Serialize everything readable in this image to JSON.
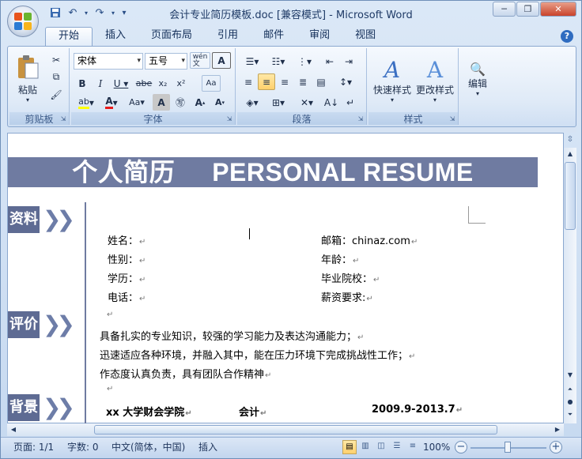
{
  "window": {
    "title": "会计专业简历模板.doc [兼容模式] - Microsoft Word"
  },
  "qat": {
    "save": "save-icon",
    "undo": "undo-icon",
    "redo": "redo-icon",
    "customize": "▾"
  },
  "tabs": [
    "开始",
    "插入",
    "页面布局",
    "引用",
    "邮件",
    "审阅",
    "视图"
  ],
  "ribbon": {
    "clipboard": {
      "paste": "粘贴",
      "label": "剪贴板"
    },
    "font": {
      "name": "宋体",
      "size": "五号",
      "label": "字体",
      "wen": "wén\n文"
    },
    "paragraph": {
      "label": "段落"
    },
    "styles": {
      "quick": "快速样式",
      "change": "更改样式",
      "label": "样式"
    },
    "editing": {
      "label": "编辑"
    }
  },
  "document": {
    "banner": "个人简历     PERSONAL RESUME",
    "sections": [
      "资料",
      "评价",
      "背景"
    ],
    "fields_left": [
      "姓名：",
      "性别：",
      "学历：",
      "电话："
    ],
    "fields_right": [
      "邮箱：chinaz.com",
      "年龄：",
      "毕业院校：",
      "薪资要求:"
    ],
    "evaluation": [
      "具备扎实的专业知识，较强的学习能力及表达沟通能力；",
      "迅速适应各种环境，并融入其中，能在压力环境下完成挑战性工作；",
      "作态度认真负责，具有团队合作精神"
    ],
    "education": {
      "school": "xx 大学财会学院",
      "major": "会计",
      "period": "2009.9-2013.7"
    }
  },
  "status": {
    "page": "页面: 1/1",
    "words": "字数: 0",
    "lang": "中文(简体，中国)",
    "mode": "插入",
    "zoom": "100%"
  },
  "colors": {
    "banner": "#6f7ba1",
    "section": "#5e6b93",
    "chevron": "#6d7da8"
  }
}
